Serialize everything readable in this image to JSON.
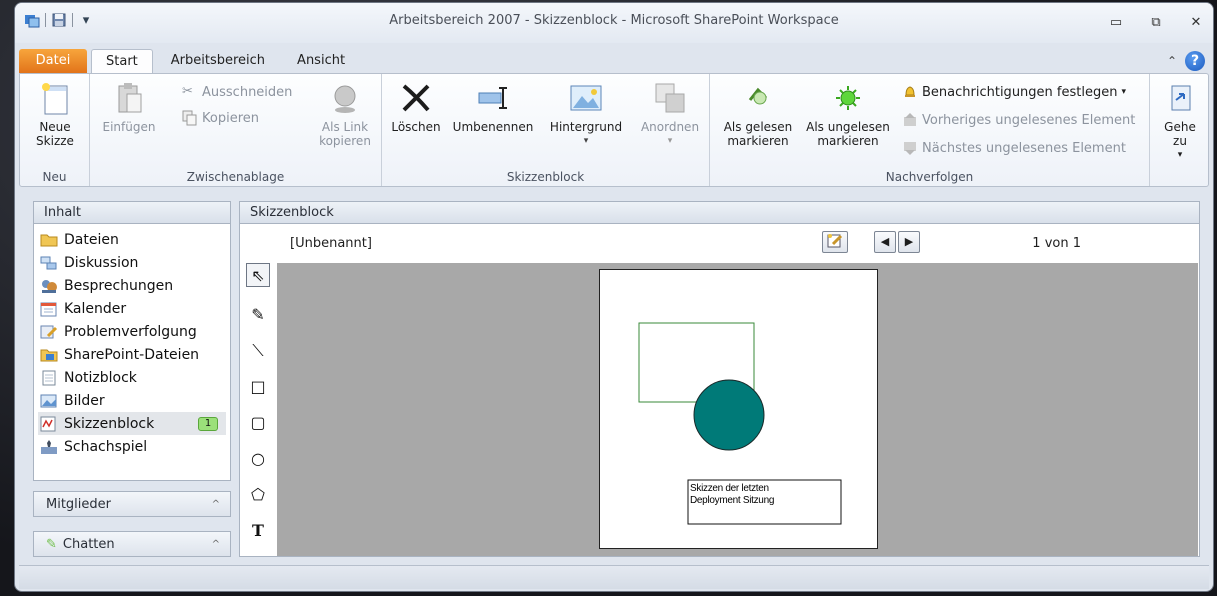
{
  "window": {
    "title": "Arbeitsbereich 2007 - Skizzenblock  -  Microsoft SharePoint Workspace"
  },
  "tabs": [
    {
      "label": "Datei"
    },
    {
      "label": "Start"
    },
    {
      "label": "Arbeitsbereich"
    },
    {
      "label": "Ansicht"
    }
  ],
  "ribbon": {
    "neu": {
      "group_label": "Neu",
      "new_sketch": "Neue Skizze"
    },
    "clipboard": {
      "group_label": "Zwischenablage",
      "paste": "Einfügen",
      "cut": "Ausschneiden",
      "copy": "Kopieren",
      "copy_as_link": "Als Link kopieren"
    },
    "sketchpad": {
      "group_label": "Skizzenblock",
      "delete": "Löschen",
      "rename": "Umbenennen",
      "background": "Hintergrund",
      "arrange": "Anordnen"
    },
    "followup": {
      "group_label": "Nachverfolgen",
      "mark_read": "Als gelesen markieren",
      "mark_unread": "Als ungelesen markieren",
      "set_alerts": "Benachrichtigungen festlegen",
      "prev_unread": "Vorheriges ungelesenes Element",
      "next_unread": "Nächstes ungelesenes Element"
    },
    "goto": {
      "label": "Gehe zu"
    }
  },
  "content_pane": {
    "header": "Inhalt",
    "items": [
      {
        "label": "Dateien",
        "icon": "folder-icon"
      },
      {
        "label": "Diskussion",
        "icon": "discussion-icon"
      },
      {
        "label": "Besprechungen",
        "icon": "meetings-icon"
      },
      {
        "label": "Kalender",
        "icon": "calendar-icon"
      },
      {
        "label": "Problemverfolgung",
        "icon": "issue-tracking-icon"
      },
      {
        "label": "SharePoint-Dateien",
        "icon": "sharepoint-files-icon"
      },
      {
        "label": "Notizblock",
        "icon": "notepad-icon"
      },
      {
        "label": "Bilder",
        "icon": "pictures-icon"
      },
      {
        "label": "Skizzenblock",
        "icon": "sketchpad-icon",
        "badge": "1"
      },
      {
        "label": "Schachspiel",
        "icon": "chess-icon"
      }
    ]
  },
  "members_pane": {
    "header": "Mitglieder"
  },
  "chat_pane": {
    "header": "Chatten"
  },
  "sketch_pane": {
    "header": "Skizzenblock",
    "doc_name": "[Unbenannt]",
    "page_count": "1 von 1",
    "text_box": "Skizzen der letzten Deployment Sitzung"
  },
  "colors": {
    "rect_stroke": "#3a8a3a",
    "circle_fill": "#007a78",
    "file_tab": "#e98a2a"
  }
}
